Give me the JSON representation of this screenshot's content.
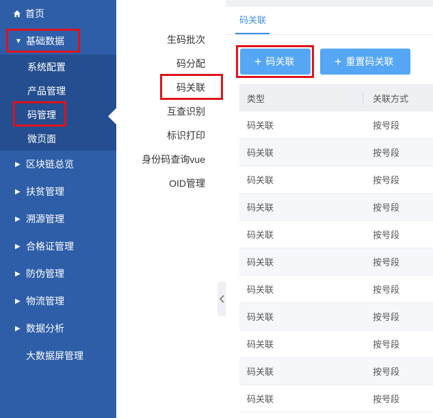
{
  "sidebar": {
    "home": "首页",
    "basic_data": "基础数据",
    "sub_items": [
      "系统配置",
      "产品管理",
      "码管理",
      "微页面"
    ],
    "items": [
      "区块链总览",
      "扶贫管理",
      "溯源管理",
      "合格证管理",
      "防伪管理",
      "物流管理",
      "数据分析"
    ],
    "bigscreen": "大数据屏管理"
  },
  "submenu": {
    "items": [
      "生码批次",
      "码分配",
      "码关联",
      "互查识别",
      "标识打印",
      "身份码查询vue",
      "OID管理"
    ]
  },
  "main": {
    "tab": "码关联",
    "buttons": {
      "code_link": "码关联",
      "reset_code_link": "重置码关联"
    },
    "table": {
      "headers": [
        "类型",
        "关联方式"
      ],
      "rows": [
        [
          "码关联",
          "按号段"
        ],
        [
          "码关联",
          "按号段"
        ],
        [
          "码关联",
          "按号段"
        ],
        [
          "码关联",
          "按号段"
        ],
        [
          "码关联",
          "按号段"
        ],
        [
          "码关联",
          "按号段"
        ],
        [
          "码关联",
          "按号段"
        ],
        [
          "码关联",
          "按号段"
        ],
        [
          "码关联",
          "按号段"
        ],
        [
          "码关联",
          "按号段"
        ],
        [
          "码关联",
          "按号段"
        ]
      ]
    }
  },
  "colors": {
    "sidebar_bg": "#2e5ea8",
    "sidebar_sub_bg": "#244e8f",
    "accent": "#3a8ee6",
    "button_bg": "#55a6f5",
    "highlight_border": "#e0121b"
  }
}
